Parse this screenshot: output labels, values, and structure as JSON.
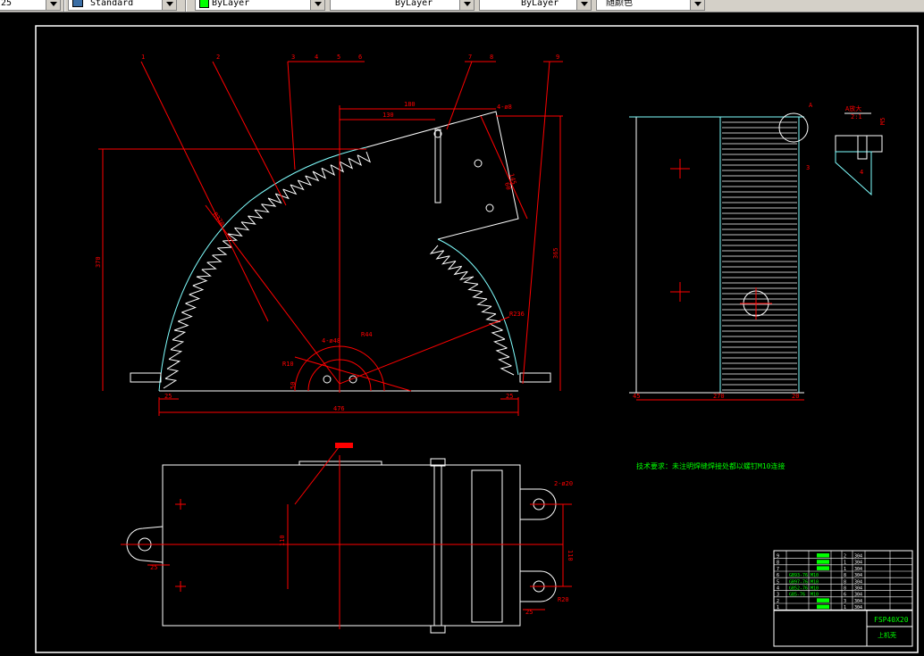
{
  "toolbar": {
    "scale_fragment": "25",
    "text_style": "Standard",
    "layer_color": "ByLayer",
    "linetype": "ByLayer",
    "lineweight": "ByLayer",
    "plot_style": "随颜色"
  },
  "drawing": {
    "leaders": [
      "1",
      "2",
      "3",
      "4",
      "5",
      "6",
      "7",
      "8",
      "9"
    ],
    "front_view": {
      "dim_180": "180",
      "dim_130": "130",
      "dim_370": "370",
      "dim_365": "365",
      "dim_476": "476",
      "dim_25_left": "25",
      "dim_25_right": "25",
      "dim_145": "145",
      "dim_60": "60",
      "dim_r_left": "R370",
      "dim_r_right": "R236",
      "dim_4x45": "4-ø8",
      "dim_left_small": "50",
      "dim_small1": "4-ø48",
      "dim_small2": "R44",
      "dim_small3": "R10"
    },
    "side_view": {
      "dim_bottom": "270",
      "dim_left": "45",
      "dim_right": "20",
      "label_3": "3",
      "label_4": "4",
      "detail_label": "A",
      "detail_title": "A放大",
      "detail_scale": "2:1",
      "detail_note": "M5"
    },
    "top_view": {
      "dim_110_left": "110",
      "dim_110_right": "110",
      "dim_25_left": "25",
      "dim_25_right": "25",
      "dim_r20": "R20",
      "dim_hole": "2-ø20"
    },
    "tech_note": "技术要求：未注明焊缝焊接处都以螺钉M10连接"
  },
  "title_block": {
    "drawing_no": "FSP40X20",
    "part_name": "上机壳",
    "rows": [
      {
        "no": "9",
        "qty": "2",
        "mat": "304"
      },
      {
        "no": "8",
        "qty": "1",
        "mat": "304"
      },
      {
        "no": "7",
        "qty": "1",
        "mat": "304"
      },
      {
        "no": "6",
        "code": "GB93-76",
        "spec": "M10",
        "qty": "8",
        "mat": "304"
      },
      {
        "no": "5",
        "code": "GB97-76",
        "spec": "M10",
        "qty": "8",
        "mat": "304"
      },
      {
        "no": "4",
        "code": "GB52-76",
        "spec": "M10",
        "qty": "8",
        "mat": "304"
      },
      {
        "no": "3",
        "code": "GB5-76",
        "spec": "M10",
        "qty": "6",
        "mat": "304"
      },
      {
        "no": "2",
        "qty": "3",
        "mat": "304"
      },
      {
        "no": "1",
        "qty": "1",
        "mat": "304"
      }
    ]
  },
  "colors": {
    "background": "#000000",
    "frame": "#ffffff",
    "center_line": "#ff0000",
    "outline": "#ffffff",
    "hatch": "#80ffff",
    "highlight": "#00ff00",
    "toolbar_bg": "#d4d0c8"
  }
}
